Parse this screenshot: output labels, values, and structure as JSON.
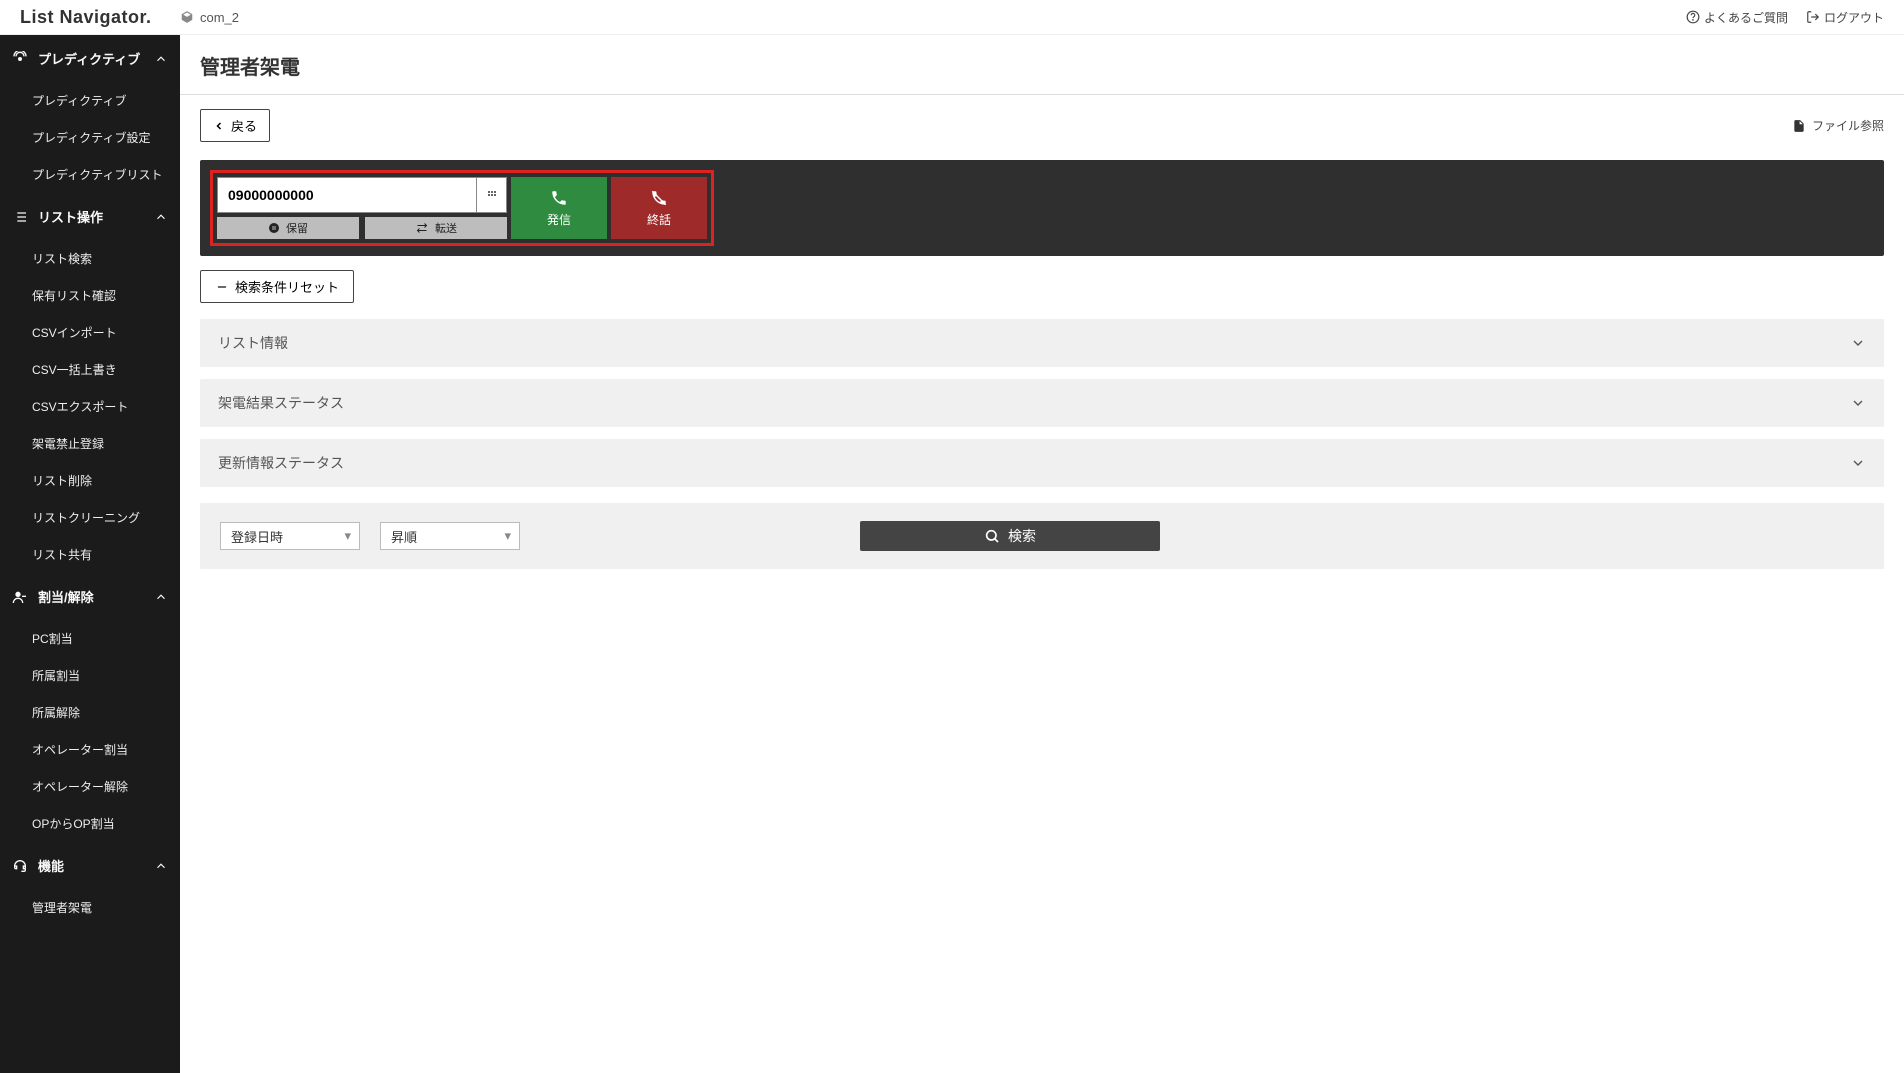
{
  "header": {
    "logo": "List Navigator.",
    "tenant": "com_2",
    "faq": "よくあるご質問",
    "logout": "ログアウト"
  },
  "sidebar": {
    "groups": [
      {
        "label": "プレディクティブ",
        "items": [
          "プレディクティブ",
          "プレディクティブ設定",
          "プレディクティブリスト"
        ]
      },
      {
        "label": "リスト操作",
        "items": [
          "リスト検索",
          "保有リスト確認",
          "CSVインポート",
          "CSV一括上書き",
          "CSVエクスポート",
          "架電禁止登録",
          "リスト削除",
          "リストクリーニング",
          "リスト共有"
        ]
      },
      {
        "label": "割当/解除",
        "items": [
          "PC割当",
          "所属割当",
          "所属解除",
          "オペレーター割当",
          "オペレーター解除",
          "OPからOP割当"
        ]
      },
      {
        "label": "機能",
        "items": [
          "管理者架電"
        ]
      }
    ]
  },
  "page": {
    "title": "管理者架電",
    "back": "戻る",
    "file_ref": "ファイル参照",
    "dial": {
      "number": "09000000000",
      "hold": "保留",
      "transfer": "転送",
      "call": "発信",
      "hangup": "終話"
    },
    "reset": "検索条件リセット",
    "accordions": [
      "リスト情報",
      "架電結果ステータス",
      "更新情報ステータス"
    ],
    "sort_field": "登録日時",
    "sort_order": "昇順",
    "search": "検索"
  }
}
